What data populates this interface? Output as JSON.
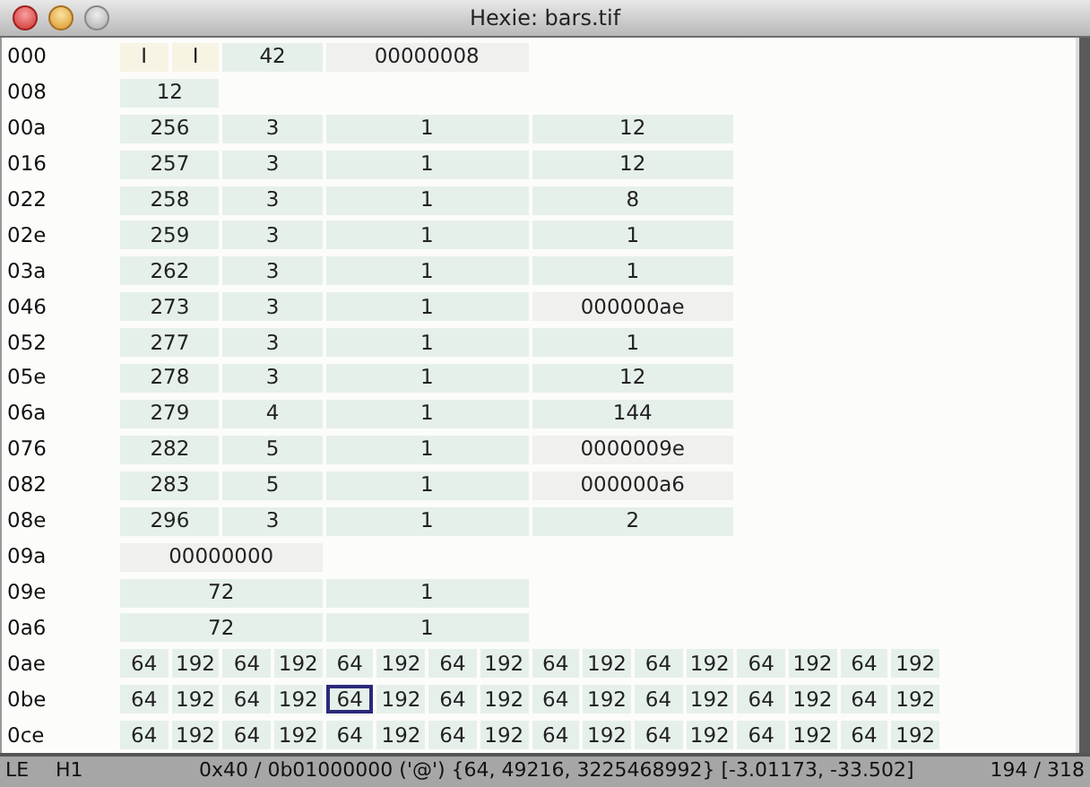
{
  "window": {
    "title": "Hexie: bars.tif"
  },
  "rows": [
    {
      "address": "000",
      "cells": [
        {
          "text": "I",
          "kind": "char",
          "selected": false
        },
        {
          "text": "I",
          "kind": "char",
          "selected": false
        },
        {
          "text": "42",
          "kind": "short",
          "selected": false
        },
        {
          "text": "00000008",
          "kind": "hex",
          "selected": false
        }
      ]
    },
    {
      "address": "008",
      "cells": [
        {
          "text": "12",
          "kind": "short",
          "selected": false
        }
      ]
    },
    {
      "address": "00a",
      "cells": [
        {
          "text": "256",
          "kind": "short",
          "selected": false
        },
        {
          "text": "3",
          "kind": "short",
          "selected": false
        },
        {
          "text": "1",
          "kind": "long",
          "selected": false
        },
        {
          "text": "12",
          "kind": "long",
          "selected": false
        }
      ]
    },
    {
      "address": "016",
      "cells": [
        {
          "text": "257",
          "kind": "short",
          "selected": false
        },
        {
          "text": "3",
          "kind": "short",
          "selected": false
        },
        {
          "text": "1",
          "kind": "long",
          "selected": false
        },
        {
          "text": "12",
          "kind": "long",
          "selected": false
        }
      ]
    },
    {
      "address": "022",
      "cells": [
        {
          "text": "258",
          "kind": "short",
          "selected": false
        },
        {
          "text": "3",
          "kind": "short",
          "selected": false
        },
        {
          "text": "1",
          "kind": "long",
          "selected": false
        },
        {
          "text": "8",
          "kind": "long",
          "selected": false
        }
      ]
    },
    {
      "address": "02e",
      "cells": [
        {
          "text": "259",
          "kind": "short",
          "selected": false
        },
        {
          "text": "3",
          "kind": "short",
          "selected": false
        },
        {
          "text": "1",
          "kind": "long",
          "selected": false
        },
        {
          "text": "1",
          "kind": "long",
          "selected": false
        }
      ]
    },
    {
      "address": "03a",
      "cells": [
        {
          "text": "262",
          "kind": "short",
          "selected": false
        },
        {
          "text": "3",
          "kind": "short",
          "selected": false
        },
        {
          "text": "1",
          "kind": "long",
          "selected": false
        },
        {
          "text": "1",
          "kind": "long",
          "selected": false
        }
      ]
    },
    {
      "address": "046",
      "cells": [
        {
          "text": "273",
          "kind": "short",
          "selected": false
        },
        {
          "text": "3",
          "kind": "short",
          "selected": false
        },
        {
          "text": "1",
          "kind": "long",
          "selected": false
        },
        {
          "text": "000000ae",
          "kind": "hex",
          "selected": false
        }
      ]
    },
    {
      "address": "052",
      "cells": [
        {
          "text": "277",
          "kind": "short",
          "selected": false
        },
        {
          "text": "3",
          "kind": "short",
          "selected": false
        },
        {
          "text": "1",
          "kind": "long",
          "selected": false
        },
        {
          "text": "1",
          "kind": "long",
          "selected": false
        }
      ]
    },
    {
      "address": "05e",
      "cells": [
        {
          "text": "278",
          "kind": "short",
          "selected": false
        },
        {
          "text": "3",
          "kind": "short",
          "selected": false
        },
        {
          "text": "1",
          "kind": "long",
          "selected": false
        },
        {
          "text": "12",
          "kind": "long",
          "selected": false
        }
      ]
    },
    {
      "address": "06a",
      "cells": [
        {
          "text": "279",
          "kind": "short",
          "selected": false
        },
        {
          "text": "4",
          "kind": "short",
          "selected": false
        },
        {
          "text": "1",
          "kind": "long",
          "selected": false
        },
        {
          "text": "144",
          "kind": "long",
          "selected": false
        }
      ]
    },
    {
      "address": "076",
      "cells": [
        {
          "text": "282",
          "kind": "short",
          "selected": false
        },
        {
          "text": "5",
          "kind": "short",
          "selected": false
        },
        {
          "text": "1",
          "kind": "long",
          "selected": false
        },
        {
          "text": "0000009e",
          "kind": "hex",
          "selected": false
        }
      ]
    },
    {
      "address": "082",
      "cells": [
        {
          "text": "283",
          "kind": "short",
          "selected": false
        },
        {
          "text": "5",
          "kind": "short",
          "selected": false
        },
        {
          "text": "1",
          "kind": "long",
          "selected": false
        },
        {
          "text": "000000a6",
          "kind": "hex",
          "selected": false
        }
      ]
    },
    {
      "address": "08e",
      "cells": [
        {
          "text": "296",
          "kind": "short",
          "selected": false
        },
        {
          "text": "3",
          "kind": "short",
          "selected": false
        },
        {
          "text": "1",
          "kind": "long",
          "selected": false
        },
        {
          "text": "2",
          "kind": "long",
          "selected": false
        }
      ]
    },
    {
      "address": "09a",
      "cells": [
        {
          "text": "00000000",
          "kind": "hex",
          "selected": false
        }
      ]
    },
    {
      "address": "09e",
      "cells": [
        {
          "text": "72",
          "kind": "long",
          "selected": false
        },
        {
          "text": "1",
          "kind": "long",
          "selected": false
        }
      ]
    },
    {
      "address": "0a6",
      "cells": [
        {
          "text": "72",
          "kind": "long",
          "selected": false
        },
        {
          "text": "1",
          "kind": "long",
          "selected": false
        }
      ]
    },
    {
      "address": "0ae",
      "cells": [
        {
          "text": "64",
          "kind": "byte",
          "selected": false
        },
        {
          "text": "192",
          "kind": "byte",
          "selected": false
        },
        {
          "text": "64",
          "kind": "byte",
          "selected": false
        },
        {
          "text": "192",
          "kind": "byte",
          "selected": false
        },
        {
          "text": "64",
          "kind": "byte",
          "selected": false
        },
        {
          "text": "192",
          "kind": "byte",
          "selected": false
        },
        {
          "text": "64",
          "kind": "byte",
          "selected": false
        },
        {
          "text": "192",
          "kind": "byte",
          "selected": false
        },
        {
          "text": "64",
          "kind": "byte",
          "selected": false
        },
        {
          "text": "192",
          "kind": "byte",
          "selected": false
        },
        {
          "text": "64",
          "kind": "byte",
          "selected": false
        },
        {
          "text": "192",
          "kind": "byte",
          "selected": false
        },
        {
          "text": "64",
          "kind": "byte",
          "selected": false
        },
        {
          "text": "192",
          "kind": "byte",
          "selected": false
        },
        {
          "text": "64",
          "kind": "byte",
          "selected": false
        },
        {
          "text": "192",
          "kind": "byte",
          "selected": false
        }
      ]
    },
    {
      "address": "0be",
      "cells": [
        {
          "text": "64",
          "kind": "byte",
          "selected": false
        },
        {
          "text": "192",
          "kind": "byte",
          "selected": false
        },
        {
          "text": "64",
          "kind": "byte",
          "selected": false
        },
        {
          "text": "192",
          "kind": "byte",
          "selected": false
        },
        {
          "text": "64",
          "kind": "byte",
          "selected": true
        },
        {
          "text": "192",
          "kind": "byte",
          "selected": false
        },
        {
          "text": "64",
          "kind": "byte",
          "selected": false
        },
        {
          "text": "192",
          "kind": "byte",
          "selected": false
        },
        {
          "text": "64",
          "kind": "byte",
          "selected": false
        },
        {
          "text": "192",
          "kind": "byte",
          "selected": false
        },
        {
          "text": "64",
          "kind": "byte",
          "selected": false
        },
        {
          "text": "192",
          "kind": "byte",
          "selected": false
        },
        {
          "text": "64",
          "kind": "byte",
          "selected": false
        },
        {
          "text": "192",
          "kind": "byte",
          "selected": false
        },
        {
          "text": "64",
          "kind": "byte",
          "selected": false
        },
        {
          "text": "192",
          "kind": "byte",
          "selected": false
        }
      ]
    },
    {
      "address": "0ce",
      "cells": [
        {
          "text": "64",
          "kind": "byte",
          "selected": false
        },
        {
          "text": "192",
          "kind": "byte",
          "selected": false
        },
        {
          "text": "64",
          "kind": "byte",
          "selected": false
        },
        {
          "text": "192",
          "kind": "byte",
          "selected": false
        },
        {
          "text": "64",
          "kind": "byte",
          "selected": false
        },
        {
          "text": "192",
          "kind": "byte",
          "selected": false
        },
        {
          "text": "64",
          "kind": "byte",
          "selected": false
        },
        {
          "text": "192",
          "kind": "byte",
          "selected": false
        },
        {
          "text": "64",
          "kind": "byte",
          "selected": false
        },
        {
          "text": "192",
          "kind": "byte",
          "selected": false
        },
        {
          "text": "64",
          "kind": "byte",
          "selected": false
        },
        {
          "text": "192",
          "kind": "byte",
          "selected": false
        },
        {
          "text": "64",
          "kind": "byte",
          "selected": false
        },
        {
          "text": "192",
          "kind": "byte",
          "selected": false
        },
        {
          "text": "64",
          "kind": "byte",
          "selected": false
        },
        {
          "text": "192",
          "kind": "byte",
          "selected": false
        }
      ]
    }
  ],
  "status_bar": {
    "endian": "LE",
    "mode": "H1",
    "value": "0x40 / 0b01000000 ('@') {64, 49216, 3225468992} [-3.01173, -33.502]",
    "position": "194 / 318"
  }
}
